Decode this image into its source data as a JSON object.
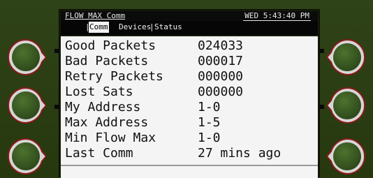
{
  "header": {
    "app_title": "FLOW MAX Comm",
    "datetime": "WED 5:43:40 PM"
  },
  "tabs": [
    {
      "label": "Comm",
      "selected": true
    },
    {
      "label": "Devices",
      "selected": false
    },
    {
      "label": "Status",
      "selected": false
    }
  ],
  "tab_separator": "|",
  "stats": [
    {
      "label": "Good Packets",
      "value": "024033"
    },
    {
      "label": "Bad Packets",
      "value": "000017"
    },
    {
      "label": "Retry Packets",
      "value": "000000"
    },
    {
      "label": "Lost Sats",
      "value": "000000"
    },
    {
      "label": "My Address",
      "value": "1-0"
    },
    {
      "label": "Max Address",
      "value": "1-5"
    },
    {
      "label": "Min Flow Max",
      "value": "1-0"
    },
    {
      "label": "Last Comm",
      "value": "27 mins ago"
    }
  ],
  "softkeys": {
    "left": [
      "softkey-icon",
      "softkey-icon",
      "softkey-icon"
    ],
    "right": [
      "softkey-icon",
      "softkey-icon",
      "softkey-icon"
    ]
  },
  "colors": {
    "bezel": "#2a3a14",
    "key_face": "#3a5a22",
    "key_ring": "#b8b8b8",
    "key_rim": "#8a1a18",
    "content_bg": "#f4f4f4",
    "title_bg": "#0b0b0b"
  }
}
